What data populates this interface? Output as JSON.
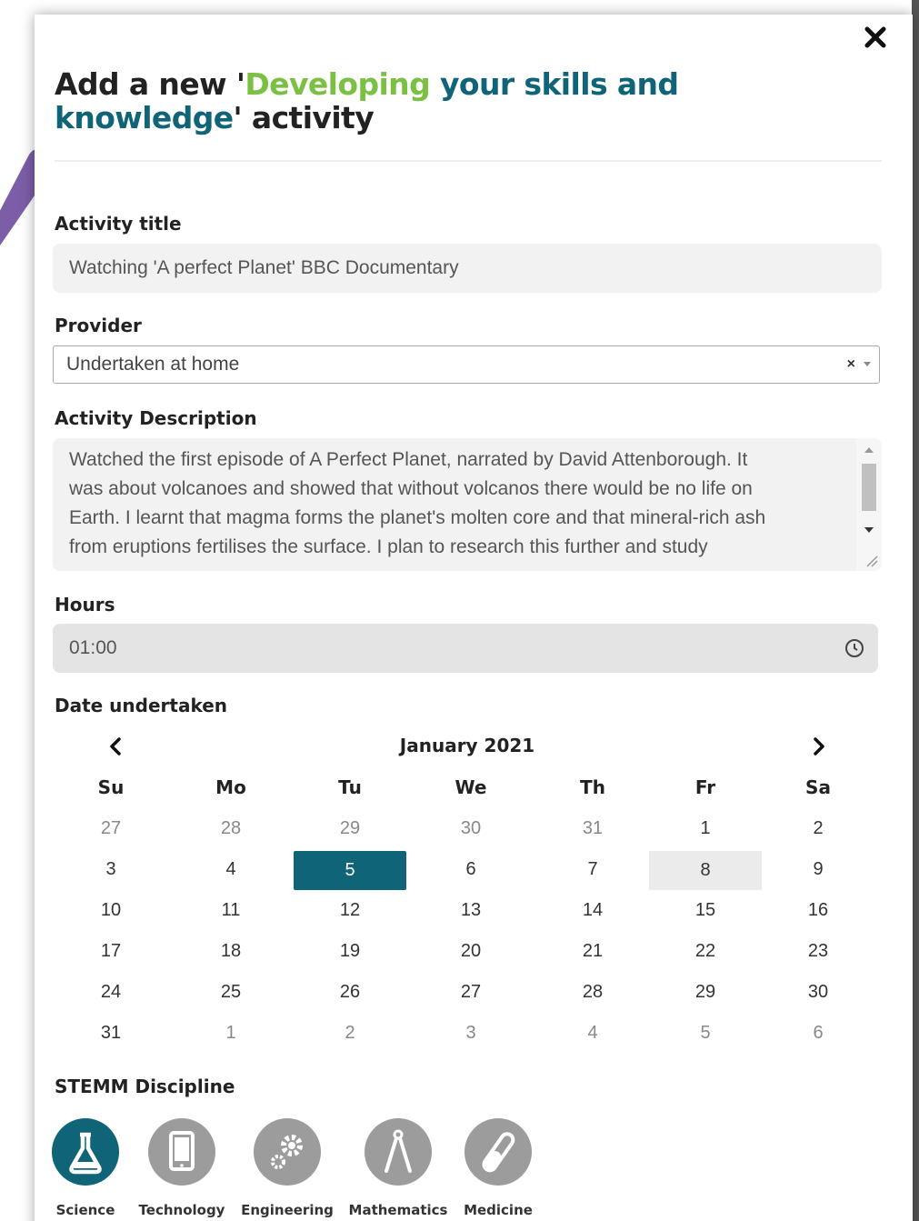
{
  "colors": {
    "accent_teal": "#0f6477",
    "accent_green": "#7ac143",
    "inactive_icon": "#9c9c9c",
    "arrow_purple": "#7b5ea7"
  },
  "modal": {
    "title_part1": "Add a new '",
    "title_green": "Developing",
    "title_teal": " your skills and knowledge",
    "title_part2": "' activity",
    "close_icon": "close-icon"
  },
  "form": {
    "activity_title": {
      "label": "Activity title",
      "value": "Watching 'A perfect Planet' BBC Documentary"
    },
    "provider": {
      "label": "Provider",
      "value": "Undertaken at home",
      "clear_glyph": "×"
    },
    "description": {
      "label": "Activity Description",
      "value": "Watched the first episode of A Perfect Planet, narrated by David  Attenborough. It\nwas about volcanoes and showed that without volcanos there would be no life on\nEarth. I learnt that magma forms the planet's molten core and that mineral-rich ash\nfrom eruptions fertilises the surface. I plan to research this further and study"
    },
    "hours": {
      "label": "Hours",
      "value": "01:00",
      "icon": "clock-icon"
    },
    "date": {
      "label": "Date undertaken",
      "month_label": "January 2021",
      "days_of_week": [
        "Su",
        "Mo",
        "Tu",
        "We",
        "Th",
        "Fr",
        "Sa"
      ],
      "weeks": [
        [
          "27",
          "28",
          "29",
          "30",
          "31",
          "1",
          "2"
        ],
        [
          "3",
          "4",
          "5",
          "6",
          "7",
          "8",
          "9"
        ],
        [
          "10",
          "11",
          "12",
          "13",
          "14",
          "15",
          "16"
        ],
        [
          "17",
          "18",
          "19",
          "20",
          "21",
          "22",
          "23"
        ],
        [
          "24",
          "25",
          "26",
          "27",
          "28",
          "29",
          "30"
        ],
        [
          "31",
          "1",
          "2",
          "3",
          "4",
          "5",
          "6"
        ]
      ],
      "selected_day": "5",
      "highlighted_day": "8"
    },
    "stemm": {
      "label": "STEMM Discipline",
      "items": [
        {
          "label": "Science",
          "icon": "flask-icon",
          "selected": true
        },
        {
          "label": "Technology",
          "icon": "tablet-icon",
          "selected": false
        },
        {
          "label": "Engineering",
          "icon": "gears-icon",
          "selected": false
        },
        {
          "label": "Mathematics",
          "icon": "compass-icon",
          "selected": false
        },
        {
          "label": "Medicine",
          "icon": "pill-icon",
          "selected": false
        }
      ]
    }
  }
}
